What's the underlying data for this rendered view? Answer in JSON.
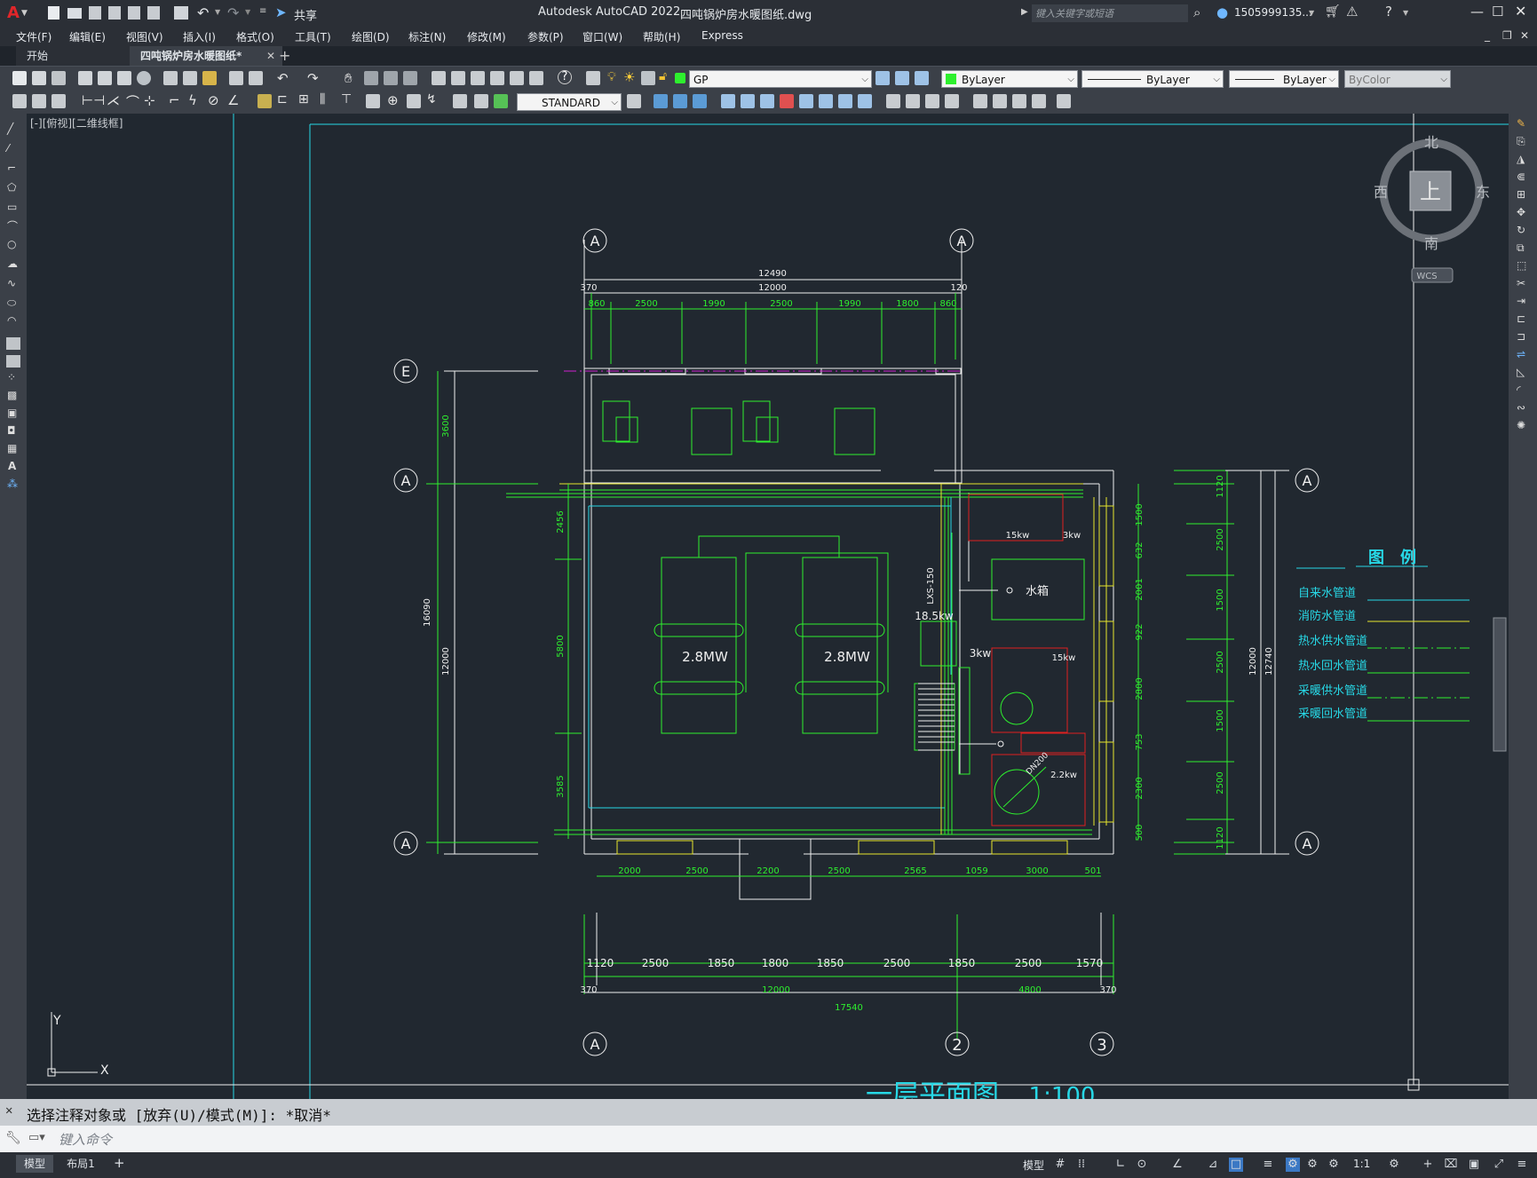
{
  "title_bar": {
    "app_title": "Autodesk AutoCAD 2022",
    "file_name": "四吨锅炉房水暖图纸.dwg",
    "share_label": "共享",
    "search_placeholder": "键入关键字或短语",
    "user_name": "1505999135...",
    "app_menu_letter": "A"
  },
  "menu": {
    "items": [
      "文件(F)",
      "编辑(E)",
      "视图(V)",
      "插入(I)",
      "格式(O)",
      "工具(T)",
      "绘图(D)",
      "标注(N)",
      "修改(M)",
      "参数(P)",
      "窗口(W)",
      "帮助(H)",
      "Express"
    ]
  },
  "doc_tabs": {
    "start": "开始",
    "active": "四吨锅炉房水暖图纸*",
    "add": "+"
  },
  "toolbar": {
    "layer": "GP",
    "color": "ByLayer",
    "linetype": "ByLayer",
    "lineweight": "ByLayer",
    "plotstyle": "ByColor",
    "text_style": "STANDARD"
  },
  "viewport": {
    "label": "[-][俯视][二维线框]",
    "viewcube": {
      "north": "北",
      "south": "南",
      "east": "东",
      "west": "西",
      "top": "上",
      "wcs": "WCS"
    },
    "ucs": {
      "x": "X",
      "y": "Y"
    }
  },
  "drawing": {
    "title": "一层平面图",
    "scale": "1:100",
    "boiler_capacity": "2.8MW",
    "water_tank": "水箱",
    "dims_top": {
      "total": "12490",
      "inner": "12000",
      "left": "370",
      "right": "120",
      "segments": [
        "860",
        "2500",
        "1990",
        "2500",
        "1990",
        "1800",
        "860"
      ]
    },
    "dims_left": [
      "3600",
      "16090",
      "12000",
      "2456",
      "5800",
      "3585",
      "120",
      "370"
    ],
    "dims_right": [
      "1120",
      "2500",
      "1500",
      "2500",
      "1500",
      "2500",
      "1120",
      "12000",
      "12740",
      "370",
      "370",
      "632",
      "1500",
      "2001",
      "922",
      "2800",
      "753",
      "2300",
      "500"
    ],
    "dims_bottom_inner": [
      "2000",
      "2500",
      "2200",
      "2500",
      "2565",
      "1059",
      "3000",
      "501"
    ],
    "dims_bottom_outer": [
      "1120",
      "2500",
      "1850",
      "1800",
      "1850",
      "2500",
      "1850",
      "2500",
      "1570"
    ],
    "dims_bottom_total": {
      "left": "370",
      "a": "12000",
      "b": "4800",
      "right": "370",
      "total": "17540"
    },
    "axis_labels": {
      "a": "A",
      "e": "E",
      "two": "2",
      "three": "3"
    },
    "equipment_labels": [
      "15kw",
      "3kw",
      "18.5kw",
      "3kw",
      "15kw",
      "2.2kw",
      "LXS-150",
      "DN200"
    ],
    "legend": {
      "title": "图　例",
      "items": [
        "自来水管道",
        "消防水管道",
        "热水供水管道",
        "热水回水管道",
        "采暖供水管道",
        "采暖回水管道"
      ]
    }
  },
  "command": {
    "history": "选择注释对象或 [放弃(U)/模式(M)]: *取消*",
    "placeholder": "键入命令"
  },
  "status": {
    "layout_tabs": [
      "模型",
      "布局1"
    ],
    "add": "+",
    "model_label": "模型",
    "scale": "1:1"
  },
  "colors": {
    "accent_green": "#2ef02e",
    "cyan": "#27d8e6",
    "yellow": "#e6e62e",
    "red": "#e02020",
    "magenta": "#d020d0",
    "white": "#f0f0f0",
    "canvas_bg": "#212830"
  }
}
